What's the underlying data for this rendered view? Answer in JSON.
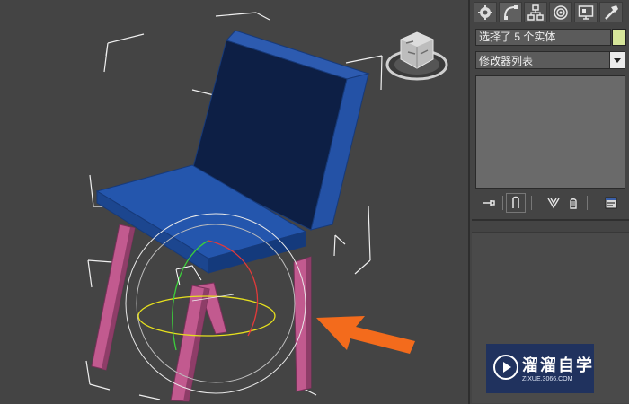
{
  "viewport": {
    "label": "3D viewport - chair model"
  },
  "view_cube": {
    "label": "ViewCube"
  },
  "command_panel": {
    "tabs": [
      {
        "name": "create",
        "icon": "create-icon"
      },
      {
        "name": "modify",
        "icon": "modify-icon"
      },
      {
        "name": "hierarchy",
        "icon": "hierarchy-icon"
      },
      {
        "name": "motion",
        "icon": "motion-icon"
      },
      {
        "name": "display",
        "icon": "display-icon"
      },
      {
        "name": "utilities",
        "icon": "utilities-icon"
      }
    ],
    "selection_name": "选择了 5 个实体",
    "selection_color": "#d6e59a",
    "modifier_list_label": "修改器列表",
    "stack_buttons": [
      "pin-stack-icon",
      "show-end-result-icon",
      "make-unique-icon",
      "remove-modifier-icon",
      "configure-modifier-sets-icon"
    ]
  },
  "watermark": {
    "title": "溜溜自学",
    "url": "ZIXUE.3066.COM"
  },
  "colors": {
    "viewport_bg": "#444444",
    "chair_seat": "#1e4a9a",
    "chair_legs": "#c05a8e",
    "arrow": "#f36b1c"
  }
}
